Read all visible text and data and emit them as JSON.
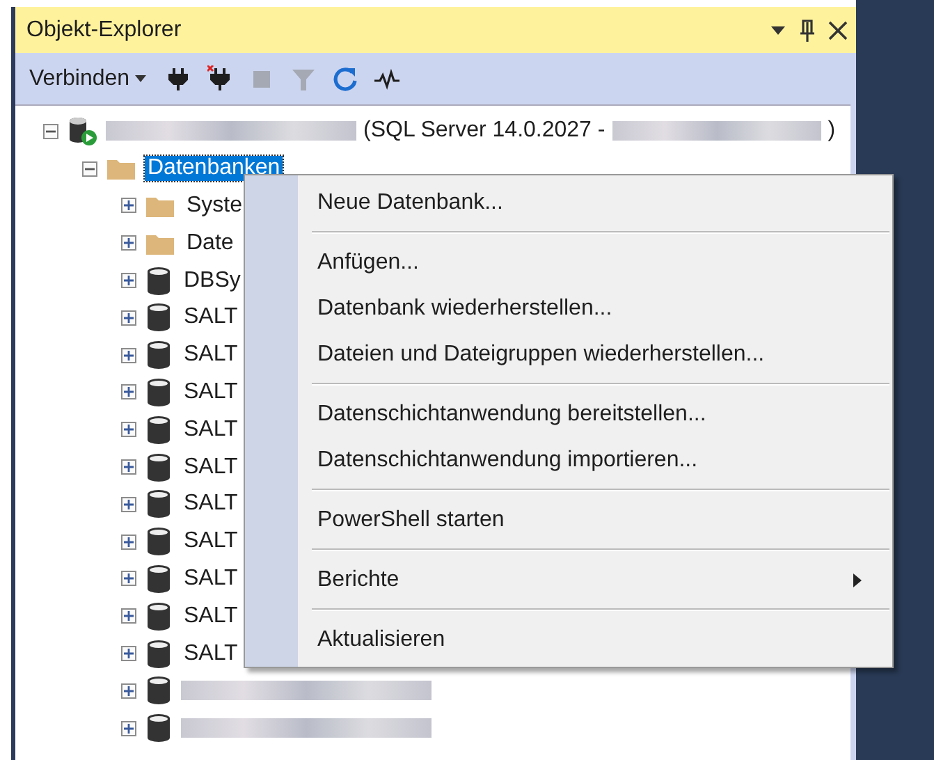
{
  "window": {
    "title": "Objekt-Explorer",
    "buttons": [
      {
        "kind": "dropdown"
      },
      {
        "kind": "pin"
      },
      {
        "kind": "close"
      }
    ]
  },
  "toolbar": {
    "connect": {
      "label": "Verbinden"
    },
    "tools": [
      {
        "kind": "connect",
        "disabled": false
      },
      {
        "kind": "disconnect",
        "disabled": false
      },
      {
        "kind": "stop",
        "disabled": true
      },
      {
        "kind": "filter",
        "disabled": true
      },
      {
        "kind": "refresh",
        "disabled": false
      },
      {
        "kind": "activity",
        "disabled": false
      }
    ]
  },
  "tree": [
    {
      "kind": "server",
      "expanded": true,
      "selected": false,
      "label": [
        {
          "kind": "blurred-long"
        },
        {
          "kind": "text",
          "text": "(SQL Server 14.0.2027 - "
        },
        {
          "kind": "blurred-short"
        },
        {
          "kind": "text",
          "text": ")"
        }
      ],
      "children": [
        {
          "kind": "folder",
          "expanded": true,
          "selected": true,
          "label": [
            {
              "kind": "text",
              "text": "Datenbanken"
            }
          ],
          "children": [
            {
              "kind": "folder",
              "expanded": false,
              "selected": false,
              "label": [
                {
                  "kind": "text",
                  "text": "Syste"
                }
              ]
            },
            {
              "kind": "folder",
              "expanded": false,
              "selected": false,
              "label": [
                {
                  "kind": "text",
                  "text": "Date"
                }
              ]
            },
            {
              "kind": "database",
              "expanded": false,
              "selected": false,
              "label": [
                {
                  "kind": "text",
                  "text": "DBSy"
                }
              ]
            },
            {
              "kind": "database",
              "expanded": false,
              "selected": false,
              "label": [
                {
                  "kind": "text",
                  "text": "SALT"
                }
              ]
            },
            {
              "kind": "database",
              "expanded": false,
              "selected": false,
              "label": [
                {
                  "kind": "text",
                  "text": "SALT"
                }
              ]
            },
            {
              "kind": "database",
              "expanded": false,
              "selected": false,
              "label": [
                {
                  "kind": "text",
                  "text": "SALT"
                }
              ]
            },
            {
              "kind": "database",
              "expanded": false,
              "selected": false,
              "label": [
                {
                  "kind": "text",
                  "text": "SALT"
                }
              ]
            },
            {
              "kind": "database",
              "expanded": false,
              "selected": false,
              "label": [
                {
                  "kind": "text",
                  "text": "SALT"
                }
              ]
            },
            {
              "kind": "database",
              "expanded": false,
              "selected": false,
              "label": [
                {
                  "kind": "text",
                  "text": "SALT"
                }
              ]
            },
            {
              "kind": "database",
              "expanded": false,
              "selected": false,
              "label": [
                {
                  "kind": "text",
                  "text": "SALT"
                }
              ]
            },
            {
              "kind": "database",
              "expanded": false,
              "selected": false,
              "label": [
                {
                  "kind": "text",
                  "text": "SALT"
                }
              ]
            },
            {
              "kind": "database",
              "expanded": false,
              "selected": false,
              "label": [
                {
                  "kind": "text",
                  "text": "SALT"
                }
              ]
            },
            {
              "kind": "database",
              "expanded": false,
              "selected": false,
              "label": [
                {
                  "kind": "text",
                  "text": "SALT"
                }
              ]
            },
            {
              "kind": "database",
              "expanded": false,
              "selected": false,
              "label": [
                {
                  "kind": "blurred-long"
                }
              ]
            },
            {
              "kind": "database",
              "expanded": false,
              "selected": false,
              "label": [
                {
                  "kind": "blurred-long"
                }
              ]
            }
          ]
        }
      ]
    }
  ],
  "context_menu": {
    "items": [
      {
        "kind": "item",
        "label": "Neue Datenbank...",
        "submenu": false
      },
      {
        "kind": "separator"
      },
      {
        "kind": "item",
        "label": "Anfügen...",
        "submenu": false
      },
      {
        "kind": "item",
        "label": "Datenbank wiederherstellen...",
        "submenu": false
      },
      {
        "kind": "item",
        "label": "Dateien und Dateigruppen wiederherstellen...",
        "submenu": false
      },
      {
        "kind": "separator"
      },
      {
        "kind": "item",
        "label": "Datenschichtanwendung bereitstellen...",
        "submenu": false
      },
      {
        "kind": "item",
        "label": "Datenschichtanwendung importieren...",
        "submenu": false
      },
      {
        "kind": "separator"
      },
      {
        "kind": "item",
        "label": "PowerShell starten",
        "submenu": false
      },
      {
        "kind": "separator"
      },
      {
        "kind": "item",
        "label": "Berichte",
        "submenu": true
      },
      {
        "kind": "separator"
      },
      {
        "kind": "item",
        "label": "Aktualisieren",
        "submenu": false
      }
    ]
  }
}
